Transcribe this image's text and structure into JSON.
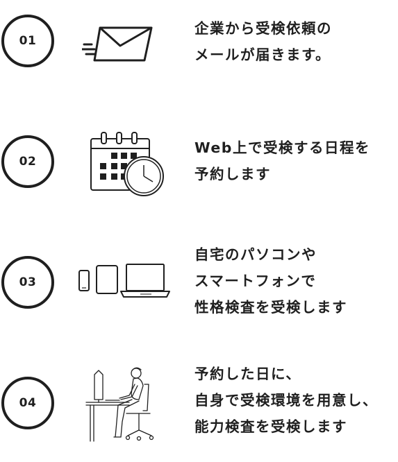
{
  "steps": [
    {
      "number": "01",
      "icon": "envelope-icon",
      "lines": [
        "企業から受検依頼の",
        "メールが届きます。"
      ]
    },
    {
      "number": "02",
      "icon": "calendar-clock-icon",
      "lines": [
        "Web上で受検する日程を",
        "予約します"
      ]
    },
    {
      "number": "03",
      "icon": "devices-icon",
      "lines": [
        "自宅のパソコンや",
        "スマートフォンで",
        "性格検査を受検します"
      ]
    },
    {
      "number": "04",
      "icon": "person-at-desk-icon",
      "lines": [
        "予約した日に、",
        "自身で受検環境を用意し、",
        "能力検査を受検します"
      ]
    }
  ]
}
